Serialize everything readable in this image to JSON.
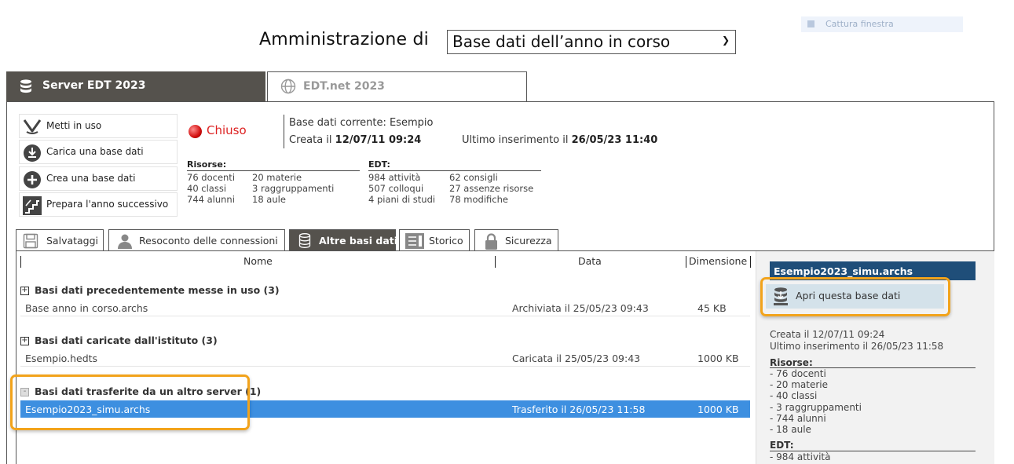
{
  "header": {
    "admin_label": "Amministrazione di",
    "db_select_value": "Base dati dell’anno in corso",
    "capture_label": "Cattura finestra"
  },
  "server_tabs": [
    {
      "label": "Server EDT 2023",
      "icon": "database-icon",
      "active": true
    },
    {
      "label": "EDT.net 2023",
      "icon": "globe-icon",
      "active": false
    }
  ],
  "actions": [
    {
      "label": "Metti in uso",
      "icon": "m-logo-icon"
    },
    {
      "label": "Carica una base dati",
      "icon": "download-icon"
    },
    {
      "label": "Crea una base dati",
      "icon": "plus-circle-icon"
    },
    {
      "label": "Prepara l'anno successivo",
      "icon": "stairs-icon"
    }
  ],
  "status": {
    "label": "Chiuso",
    "color": "#d22222"
  },
  "current_db": {
    "name_line": "Base dati corrente: Esempio",
    "created_prefix": "Creata il",
    "created": "12/07/11 09:24",
    "last_prefix": "Ultimo inserimento il",
    "last": "26/05/23 11:40"
  },
  "stats": {
    "resources": {
      "title": "Risorse:",
      "col1": [
        "76 docenti",
        "40 classi",
        "744 alunni"
      ],
      "col2": [
        "20 materie",
        "3 raggruppamenti",
        "18 aule"
      ]
    },
    "edt": {
      "title": "EDT:",
      "col1": [
        "984 attività",
        "507 colloqui",
        "4 piani di studi"
      ],
      "col2": [
        "62 consigli",
        "27 assenze risorse",
        "78 modifiche"
      ]
    }
  },
  "sub_tabs": [
    {
      "label": "Salvataggi",
      "icon": "save-icon"
    },
    {
      "label": "Resoconto delle connessioni",
      "icon": "user-icon"
    },
    {
      "label": "Altre basi dati",
      "icon": "database-icon",
      "active": true
    },
    {
      "label": "Storico",
      "icon": "history-icon"
    },
    {
      "label": "Sicurezza",
      "icon": "lock-icon"
    }
  ],
  "columns": {
    "name": "Nome",
    "date": "Data",
    "size": "Dimensione"
  },
  "groups": [
    {
      "label": "Basi dati precedentemente messe in uso (3)",
      "toggle": "+",
      "rows": [
        {
          "name": "Base anno in corso.archs",
          "date": "Archiviata il 25/05/23 09:43",
          "size": "45 KB"
        }
      ]
    },
    {
      "label": "Basi dati caricate dall'istituto (3)",
      "toggle": "+",
      "rows": [
        {
          "name": "Esempio.hedts",
          "date": "Caricata il 25/05/23 09:43",
          "size": "1000 KB"
        }
      ]
    },
    {
      "label": "Basi dati trasferite da un altro server (1)",
      "toggle": "-",
      "rows": [
        {
          "name": "Esempio2023_simu.archs",
          "date": "Trasferito il 26/05/23 11:58",
          "size": "1000 KB",
          "selected": true
        }
      ]
    }
  ],
  "detail": {
    "title": "Esempio2023_simu.archs",
    "open_button": "Apri questa base dati",
    "created": "Creata il 12/07/11 09:24",
    "last": "Ultimo inserimento il 26/05/23 11:58",
    "resources_title": "Risorse:",
    "resources": [
      "- 76 docenti",
      "- 20 materie",
      "- 40 classi",
      "- 3 raggruppamenti",
      "- 744 alunni",
      "- 18 aule"
    ],
    "edt_title": "EDT:",
    "edt": [
      "- 984 attività"
    ]
  },
  "colors": {
    "dark_tab": "#55524d",
    "selection": "#3d8fe0",
    "detail_title": "#1f4e79",
    "highlight": "#f2a31b",
    "open_button": "#d4e2ea"
  }
}
